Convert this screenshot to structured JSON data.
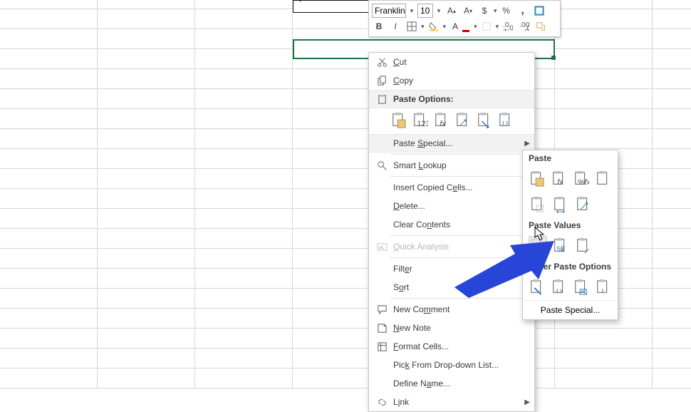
{
  "toolbar": {
    "font_name": "Franklin",
    "font_size": "10",
    "bold": "B",
    "italic": "I"
  },
  "active_cell_value": "'",
  "context_menu": {
    "cut": "Cut",
    "copy": "Copy",
    "paste_options": "Paste Options:",
    "paste_special": "Paste Special...",
    "smart_lookup": "Smart Lookup",
    "insert_copied_cells": "Insert Copied Cells...",
    "delete": "Delete...",
    "clear_contents": "Clear Contents",
    "quick_analysis": "Quick Analysis",
    "filter": "Filter",
    "sort": "Sort",
    "new_comment": "New Comment",
    "new_note": "New Note",
    "format_cells": "Format Cells...",
    "pick_list": "Pick From Drop-down List...",
    "define_name": "Define Name...",
    "link": "Link"
  },
  "submenu": {
    "paste": "Paste",
    "paste_values": "Paste Values",
    "other_paste_options": "Other Paste Options",
    "paste_special": "Paste Special..."
  }
}
